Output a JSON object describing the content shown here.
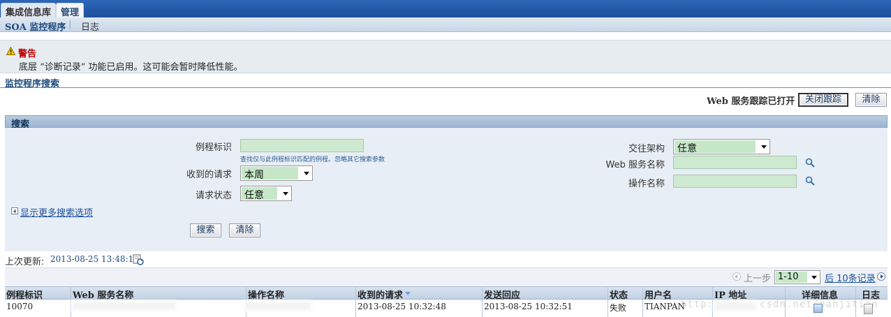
{
  "tabs": [
    "集成信息库",
    "管理"
  ],
  "subnav": {
    "active": "SOA 监控程序",
    "separator": "|",
    "other": "日志"
  },
  "warning": {
    "title": "警告",
    "message": "底层 “诊断记录” 功能已启用。这可能会暂时降低性能。"
  },
  "section_title": "监控程序搜索",
  "trace": {
    "status": "Web 服务跟踪已打开",
    "stop_button": "关闭跟踪",
    "clear_button": "清除"
  },
  "search": {
    "header": "搜索",
    "routine_id_label": "例程标识",
    "routine_id_value": "",
    "routine_id_hint": "查找仅与此例程标识匹配的例程。忽略其它搜索参数",
    "received_label": "收到的请求",
    "received_value": "本周",
    "status_label": "请求状态",
    "status_value": "任意",
    "architecture_label": "交往架构",
    "architecture_value": "任意",
    "service_label": "Web 服务名称",
    "service_value": "",
    "operation_label": "操作名称",
    "operation_value": "",
    "more_options": "显示更多搜索选项",
    "search_button": "搜索",
    "clear_button": "清除"
  },
  "refresh": {
    "label": "上次更新:",
    "time": "2013-08-25 13:48:15"
  },
  "pagination": {
    "prev": "上一步",
    "range": "1-10",
    "next": "后 10条记录"
  },
  "table": {
    "columns": [
      "例程标识",
      "Web 服务名称",
      "操作名称",
      "收到的请求",
      "发送回应",
      "状态",
      "用户名",
      "IP 地址",
      "详细信息",
      "日志"
    ],
    "rows": [
      {
        "id": "10070",
        "service": "",
        "operation": "",
        "received": "2013-08-25 10:32:48",
        "sent": "2013-08-25 10:32:51",
        "status": "失败",
        "user": "TIANPAN",
        "ip": ""
      }
    ]
  },
  "watermark": "http://blog.csdn.net/panjitian",
  "colors": {
    "tab_bar": "#1b4f9a",
    "warning_title": "#c00000",
    "field_bg": "#cde9cf",
    "link": "#1b4f9a"
  },
  "icons": [
    "warning-icon",
    "search-icon",
    "refresh-icon",
    "previous-icon",
    "next-icon",
    "details-icon",
    "log-icon",
    "sort-descending-icon",
    "expand-icon"
  ]
}
